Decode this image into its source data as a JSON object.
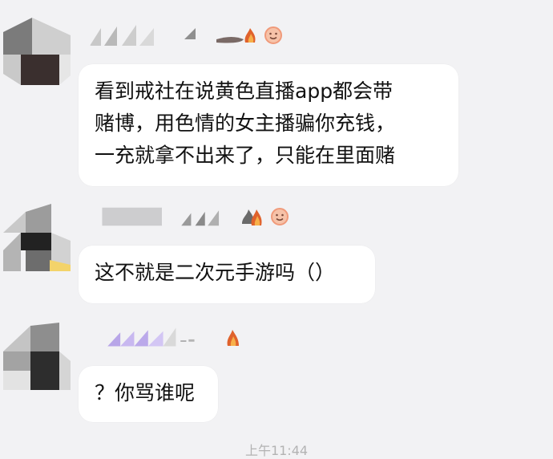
{
  "colors": {
    "background": "#f2f2f4",
    "bubble": "#ffffff",
    "text": "#111111",
    "timestamp": "#b3b3b3",
    "badge_ring": "#f09a7a"
  },
  "messages": [
    {
      "lines": [
        "看到戒社在说黄色直播app都会带",
        "赌博，用色情的女主播骗你充钱，",
        "一充就拿不出来了，只能在里面赌"
      ],
      "badges": [
        "fire-icon",
        "emoji-badge-icon"
      ]
    },
    {
      "lines": [
        "这不就是二次元手游吗（）"
      ],
      "badges": [
        "fire-icon",
        "fire-icon",
        "emoji-badge-icon"
      ]
    },
    {
      "lines": [
        "？你骂谁呢"
      ],
      "badges": [
        "fire-icon"
      ]
    }
  ],
  "timestamp": "上午11:44"
}
